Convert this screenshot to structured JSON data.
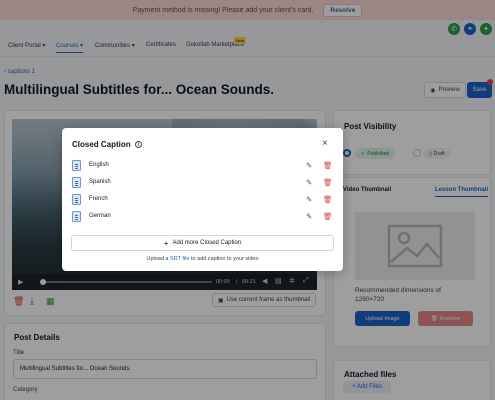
{
  "banner": {
    "message": "Payment method is missing! Please add your client's card.",
    "button": "Resolve"
  },
  "top_icons": [
    {
      "name": "phone-icon",
      "glyph": "✆",
      "color": "#2a9d4a"
    },
    {
      "name": "link-icon",
      "glyph": "⚭",
      "color": "#1e63c7"
    },
    {
      "name": "gift-icon",
      "glyph": "✦",
      "color": "#2a9d4a"
    }
  ],
  "nav": {
    "items": [
      {
        "label": "Client Portal",
        "caret": "▾"
      },
      {
        "label": "Courses",
        "caret": "▾",
        "active": true
      },
      {
        "label": "Communities",
        "caret": "▾"
      },
      {
        "label": "Certificates"
      },
      {
        "label": "Gokollab Marketplace",
        "badge": "New"
      }
    ]
  },
  "breadcrumb": {
    "arrow": "‹",
    "label": "captions 1"
  },
  "page_title": "Multilingual Subtitles for... Ocean Sounds.",
  "header_buttons": {
    "preview": "Preview",
    "save": "Save"
  },
  "player": {
    "current": "00:00",
    "separator": "/",
    "duration": "00:21"
  },
  "thumbnail_button": "Use current frame as thumbnail",
  "post_details": {
    "title": "Post Details",
    "title_label": "Title",
    "title_value": "Multilingual Subtitles for... Ocean Sounds.",
    "category_label": "Category"
  },
  "visibility": {
    "title": "Post Visibility",
    "options": [
      "Published",
      "Draft"
    ],
    "selected": "Published"
  },
  "thumbnail_panel": {
    "tabs": [
      "Video Thumbnail",
      "Lesson Thumbnail"
    ],
    "active_tab": "Lesson Thumbnail",
    "recommend_line1": "Recommended dimensions of",
    "recommend_line2": "1280×720",
    "upload": "Upload Image",
    "remove": "Remove"
  },
  "attached": {
    "title": "Attached files",
    "add": "+ Add Files"
  },
  "modal": {
    "title": "Closed Caption",
    "captions": [
      {
        "language": "English"
      },
      {
        "language": "Spanish"
      },
      {
        "language": "French"
      },
      {
        "language": "German"
      }
    ],
    "add_more": "Add more Closed Caption",
    "hint_prefix": "Upload a",
    "hint_link": "SRT file",
    "hint_suffix": "to add caption to your video"
  }
}
